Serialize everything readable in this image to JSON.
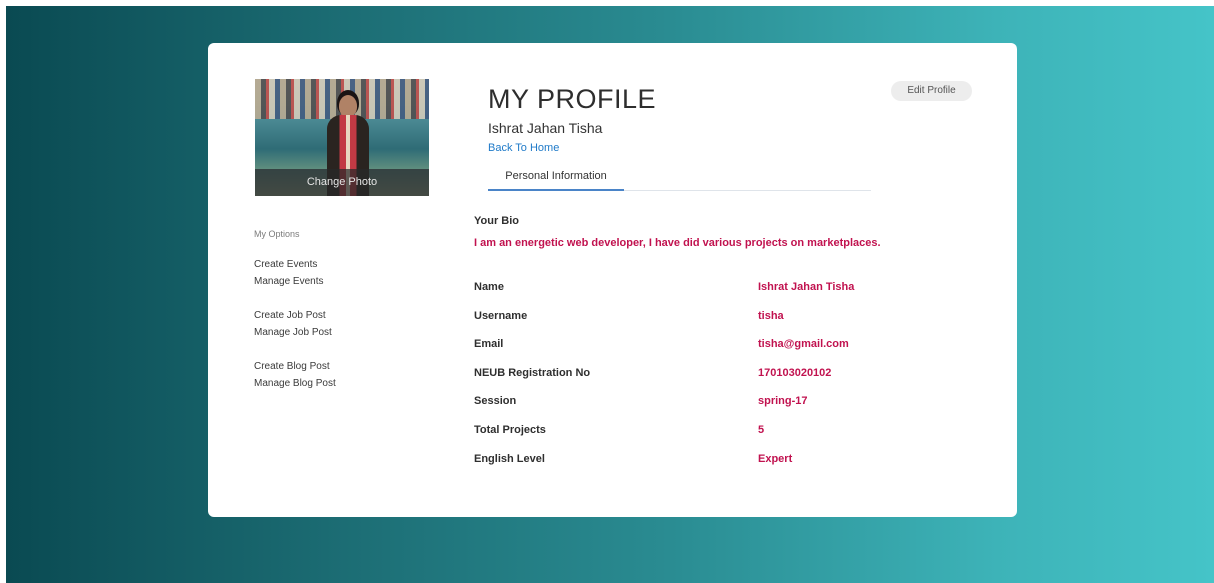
{
  "profile": {
    "title": "MY PROFILE",
    "name": "Ishrat Jahan Tisha",
    "back_link": "Back To Home",
    "edit_button": "Edit Profile",
    "tab": "Personal Information",
    "photo_caption": "Change Photo"
  },
  "sidebar": {
    "heading": "My Options",
    "groups": [
      {
        "links": [
          "Create Events",
          "Manage Events"
        ]
      },
      {
        "links": [
          "Create Job Post",
          "Manage Job Post"
        ]
      },
      {
        "links": [
          "Create Blog Post",
          "Manage Blog Post"
        ]
      }
    ]
  },
  "bio": {
    "label": "Your Bio",
    "text": "I am an energetic web developer, I have did various projects on marketplaces."
  },
  "info": [
    {
      "label": "Name",
      "value": "Ishrat Jahan Tisha"
    },
    {
      "label": "Username",
      "value": "tisha"
    },
    {
      "label": "Email",
      "value": "tisha@gmail.com"
    },
    {
      "label": "NEUB Registration No",
      "value": "170103020102"
    },
    {
      "label": "Session",
      "value": "spring-17"
    },
    {
      "label": "Total Projects",
      "value": "5"
    },
    {
      "label": "English Level",
      "value": "Expert"
    }
  ],
  "colors": {
    "accent_value": "#c1124f",
    "link": "#1f7ac8",
    "tab_underline": "#4a84c8",
    "background_dark": "#0a4a52",
    "background_light": "#45c4c8"
  }
}
